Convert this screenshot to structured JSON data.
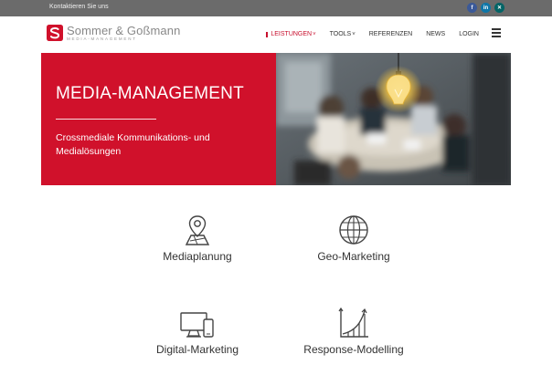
{
  "topbar": {
    "contact_label": "Kontaktieren Sie uns",
    "social": [
      {
        "icon": "facebook-icon",
        "glyph": "f"
      },
      {
        "icon": "linkedin-icon",
        "glyph": "in"
      },
      {
        "icon": "xing-icon",
        "glyph": "✕"
      }
    ]
  },
  "logo": {
    "name": "Sommer & Goßmann",
    "tagline": "MEDIA-MANAGEMENT"
  },
  "nav": {
    "items": [
      {
        "label": "LEISTUNGEN",
        "caret": "˅",
        "active": true
      },
      {
        "label": "TOOLS",
        "caret": "˅",
        "active": false
      },
      {
        "label": "REFERENZEN"
      },
      {
        "label": "NEWS"
      },
      {
        "label": "LOGIN"
      }
    ]
  },
  "hero": {
    "title": "MEDIA-MANAGEMENT",
    "subtitle": "Crossmediale Kommunikations- und Medialösungen"
  },
  "services": [
    {
      "label": "Mediaplanung",
      "icon": "map-pin-icon"
    },
    {
      "label": "Geo-Marketing",
      "icon": "globe-icon"
    },
    {
      "label": "Digital-Marketing",
      "icon": "devices-icon"
    },
    {
      "label": "Response-Modelling",
      "icon": "growth-chart-icon"
    }
  ],
  "colors": {
    "brand_red": "#d0112b",
    "topbar_gray": "#6b6b6b",
    "text": "#333333"
  }
}
